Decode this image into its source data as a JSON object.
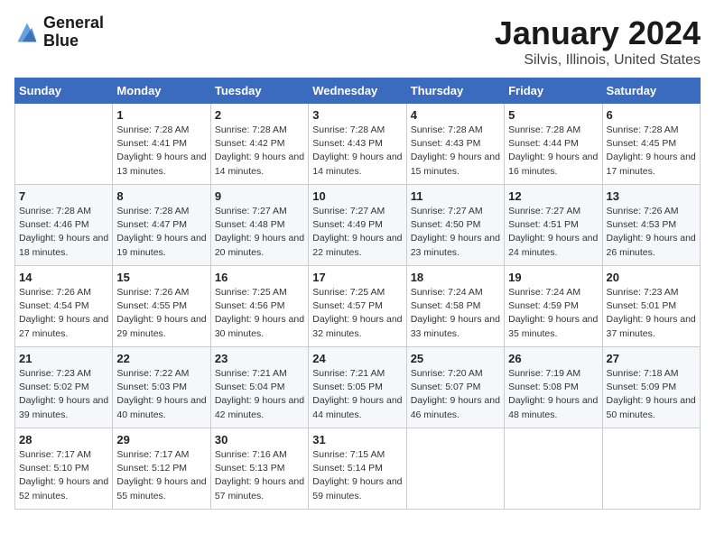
{
  "logo": {
    "line1": "General",
    "line2": "Blue"
  },
  "title": "January 2024",
  "location": "Silvis, Illinois, United States",
  "weekdays": [
    "Sunday",
    "Monday",
    "Tuesday",
    "Wednesday",
    "Thursday",
    "Friday",
    "Saturday"
  ],
  "weeks": [
    [
      {
        "day": "",
        "sunrise": "",
        "sunset": "",
        "daylight": ""
      },
      {
        "day": "1",
        "sunrise": "Sunrise: 7:28 AM",
        "sunset": "Sunset: 4:41 PM",
        "daylight": "Daylight: 9 hours and 13 minutes."
      },
      {
        "day": "2",
        "sunrise": "Sunrise: 7:28 AM",
        "sunset": "Sunset: 4:42 PM",
        "daylight": "Daylight: 9 hours and 14 minutes."
      },
      {
        "day": "3",
        "sunrise": "Sunrise: 7:28 AM",
        "sunset": "Sunset: 4:43 PM",
        "daylight": "Daylight: 9 hours and 14 minutes."
      },
      {
        "day": "4",
        "sunrise": "Sunrise: 7:28 AM",
        "sunset": "Sunset: 4:43 PM",
        "daylight": "Daylight: 9 hours and 15 minutes."
      },
      {
        "day": "5",
        "sunrise": "Sunrise: 7:28 AM",
        "sunset": "Sunset: 4:44 PM",
        "daylight": "Daylight: 9 hours and 16 minutes."
      },
      {
        "day": "6",
        "sunrise": "Sunrise: 7:28 AM",
        "sunset": "Sunset: 4:45 PM",
        "daylight": "Daylight: 9 hours and 17 minutes."
      }
    ],
    [
      {
        "day": "7",
        "sunrise": "Sunrise: 7:28 AM",
        "sunset": "Sunset: 4:46 PM",
        "daylight": "Daylight: 9 hours and 18 minutes."
      },
      {
        "day": "8",
        "sunrise": "Sunrise: 7:28 AM",
        "sunset": "Sunset: 4:47 PM",
        "daylight": "Daylight: 9 hours and 19 minutes."
      },
      {
        "day": "9",
        "sunrise": "Sunrise: 7:27 AM",
        "sunset": "Sunset: 4:48 PM",
        "daylight": "Daylight: 9 hours and 20 minutes."
      },
      {
        "day": "10",
        "sunrise": "Sunrise: 7:27 AM",
        "sunset": "Sunset: 4:49 PM",
        "daylight": "Daylight: 9 hours and 22 minutes."
      },
      {
        "day": "11",
        "sunrise": "Sunrise: 7:27 AM",
        "sunset": "Sunset: 4:50 PM",
        "daylight": "Daylight: 9 hours and 23 minutes."
      },
      {
        "day": "12",
        "sunrise": "Sunrise: 7:27 AM",
        "sunset": "Sunset: 4:51 PM",
        "daylight": "Daylight: 9 hours and 24 minutes."
      },
      {
        "day": "13",
        "sunrise": "Sunrise: 7:26 AM",
        "sunset": "Sunset: 4:53 PM",
        "daylight": "Daylight: 9 hours and 26 minutes."
      }
    ],
    [
      {
        "day": "14",
        "sunrise": "Sunrise: 7:26 AM",
        "sunset": "Sunset: 4:54 PM",
        "daylight": "Daylight: 9 hours and 27 minutes."
      },
      {
        "day": "15",
        "sunrise": "Sunrise: 7:26 AM",
        "sunset": "Sunset: 4:55 PM",
        "daylight": "Daylight: 9 hours and 29 minutes."
      },
      {
        "day": "16",
        "sunrise": "Sunrise: 7:25 AM",
        "sunset": "Sunset: 4:56 PM",
        "daylight": "Daylight: 9 hours and 30 minutes."
      },
      {
        "day": "17",
        "sunrise": "Sunrise: 7:25 AM",
        "sunset": "Sunset: 4:57 PM",
        "daylight": "Daylight: 9 hours and 32 minutes."
      },
      {
        "day": "18",
        "sunrise": "Sunrise: 7:24 AM",
        "sunset": "Sunset: 4:58 PM",
        "daylight": "Daylight: 9 hours and 33 minutes."
      },
      {
        "day": "19",
        "sunrise": "Sunrise: 7:24 AM",
        "sunset": "Sunset: 4:59 PM",
        "daylight": "Daylight: 9 hours and 35 minutes."
      },
      {
        "day": "20",
        "sunrise": "Sunrise: 7:23 AM",
        "sunset": "Sunset: 5:01 PM",
        "daylight": "Daylight: 9 hours and 37 minutes."
      }
    ],
    [
      {
        "day": "21",
        "sunrise": "Sunrise: 7:23 AM",
        "sunset": "Sunset: 5:02 PM",
        "daylight": "Daylight: 9 hours and 39 minutes."
      },
      {
        "day": "22",
        "sunrise": "Sunrise: 7:22 AM",
        "sunset": "Sunset: 5:03 PM",
        "daylight": "Daylight: 9 hours and 40 minutes."
      },
      {
        "day": "23",
        "sunrise": "Sunrise: 7:21 AM",
        "sunset": "Sunset: 5:04 PM",
        "daylight": "Daylight: 9 hours and 42 minutes."
      },
      {
        "day": "24",
        "sunrise": "Sunrise: 7:21 AM",
        "sunset": "Sunset: 5:05 PM",
        "daylight": "Daylight: 9 hours and 44 minutes."
      },
      {
        "day": "25",
        "sunrise": "Sunrise: 7:20 AM",
        "sunset": "Sunset: 5:07 PM",
        "daylight": "Daylight: 9 hours and 46 minutes."
      },
      {
        "day": "26",
        "sunrise": "Sunrise: 7:19 AM",
        "sunset": "Sunset: 5:08 PM",
        "daylight": "Daylight: 9 hours and 48 minutes."
      },
      {
        "day": "27",
        "sunrise": "Sunrise: 7:18 AM",
        "sunset": "Sunset: 5:09 PM",
        "daylight": "Daylight: 9 hours and 50 minutes."
      }
    ],
    [
      {
        "day": "28",
        "sunrise": "Sunrise: 7:17 AM",
        "sunset": "Sunset: 5:10 PM",
        "daylight": "Daylight: 9 hours and 52 minutes."
      },
      {
        "day": "29",
        "sunrise": "Sunrise: 7:17 AM",
        "sunset": "Sunset: 5:12 PM",
        "daylight": "Daylight: 9 hours and 55 minutes."
      },
      {
        "day": "30",
        "sunrise": "Sunrise: 7:16 AM",
        "sunset": "Sunset: 5:13 PM",
        "daylight": "Daylight: 9 hours and 57 minutes."
      },
      {
        "day": "31",
        "sunrise": "Sunrise: 7:15 AM",
        "sunset": "Sunset: 5:14 PM",
        "daylight": "Daylight: 9 hours and 59 minutes."
      },
      {
        "day": "",
        "sunrise": "",
        "sunset": "",
        "daylight": ""
      },
      {
        "day": "",
        "sunrise": "",
        "sunset": "",
        "daylight": ""
      },
      {
        "day": "",
        "sunrise": "",
        "sunset": "",
        "daylight": ""
      }
    ]
  ]
}
